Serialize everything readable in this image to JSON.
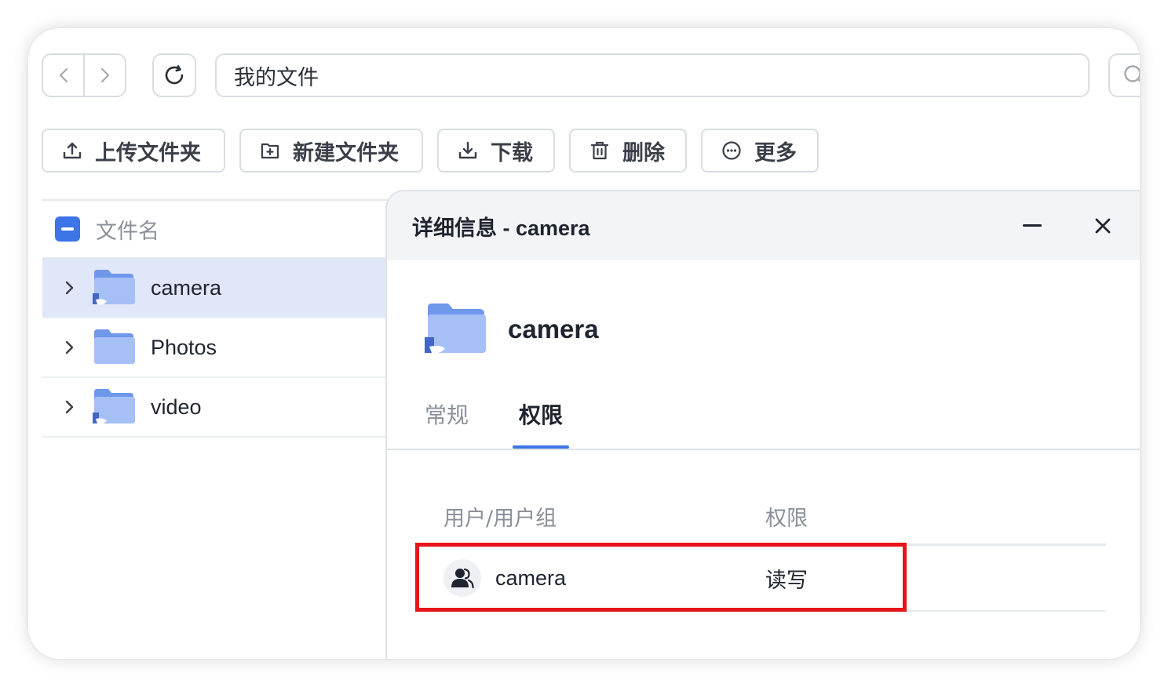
{
  "nav": {
    "path": "我的文件"
  },
  "toolbar": {
    "upload_folder": "上传文件夹",
    "new_folder": "新建文件夹",
    "download": "下载",
    "delete": "删除",
    "more": "更多"
  },
  "file_list": {
    "header": "文件名",
    "rows": [
      {
        "name": "camera",
        "selected": true
      },
      {
        "name": "Photos",
        "selected": false
      },
      {
        "name": "video",
        "selected": false
      }
    ]
  },
  "details": {
    "title": "详细信息 - camera",
    "object_name": "camera",
    "tabs": [
      "常规",
      "权限"
    ],
    "active_tab": "权限",
    "permissions": {
      "columns": [
        "用户/用户组",
        "权限"
      ],
      "rows": [
        {
          "user": "camera",
          "permission": "读写"
        }
      ]
    }
  },
  "colors": {
    "accent": "#3d74e6",
    "highlight": "#e8141b",
    "selected_row": "#dfe7f8",
    "folder": "#7ea6f4"
  }
}
